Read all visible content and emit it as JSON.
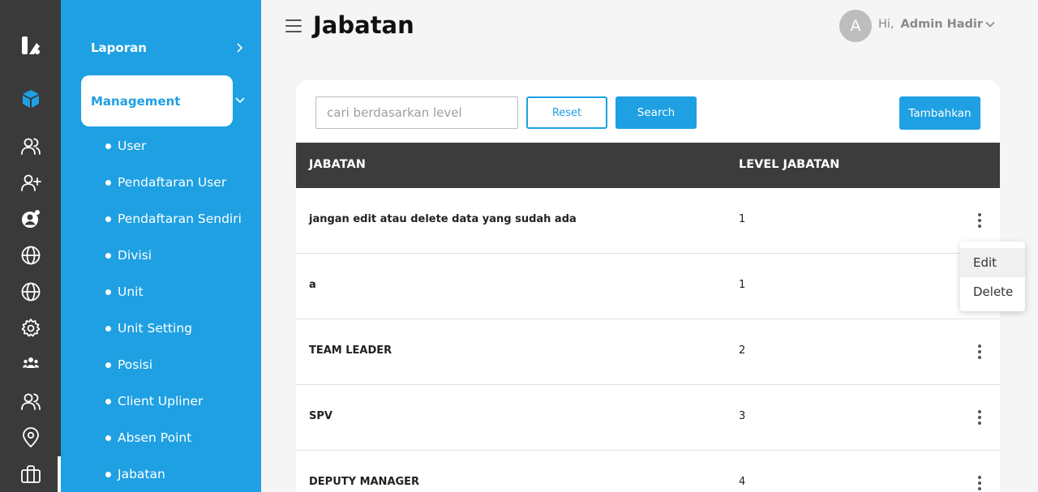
{
  "header": {
    "title": "Jabatan",
    "avatar_initial": "A",
    "greeting": "Hi,",
    "user_name": "Admin Hadir"
  },
  "nav": {
    "laporan": "Laporan",
    "management": "Management",
    "items": [
      "User",
      "Pendaftaran User",
      "Pendaftaran Sendiri",
      "Divisi",
      "Unit",
      "Unit Setting",
      "Posisi",
      "Client Upliner",
      "Absen Point",
      "Jabatan"
    ]
  },
  "toolbar": {
    "search_placeholder": "cari berdasarkan level",
    "reset_label": "Reset",
    "search_label": "Search",
    "add_label": "Tambahkan"
  },
  "table": {
    "columns": [
      "JABATAN",
      "LEVEL JABATAN"
    ],
    "rows": [
      {
        "jabatan": "jangan edit atau delete data yang sudah ada",
        "level": "1"
      },
      {
        "jabatan": "a",
        "level": "1"
      },
      {
        "jabatan": "TEAM LEADER",
        "level": "2"
      },
      {
        "jabatan": "SPV",
        "level": "3"
      },
      {
        "jabatan": "DEPUTY MANAGER",
        "level": "4"
      }
    ]
  },
  "row_menu": {
    "edit_label": "Edit",
    "delete_label": "Delete"
  },
  "colors": {
    "accent": "#1ea0e3",
    "rail": "#3a3a3a",
    "table_header": "#3c3c3c"
  },
  "rail_icons": [
    "logo-icon",
    "cube-icon",
    "users-icon",
    "user-plus-icon",
    "user-gear-icon",
    "globe-icon",
    "globe-icon",
    "settings-icon",
    "team-icon",
    "users-icon",
    "location-icon",
    "briefcase-icon"
  ]
}
